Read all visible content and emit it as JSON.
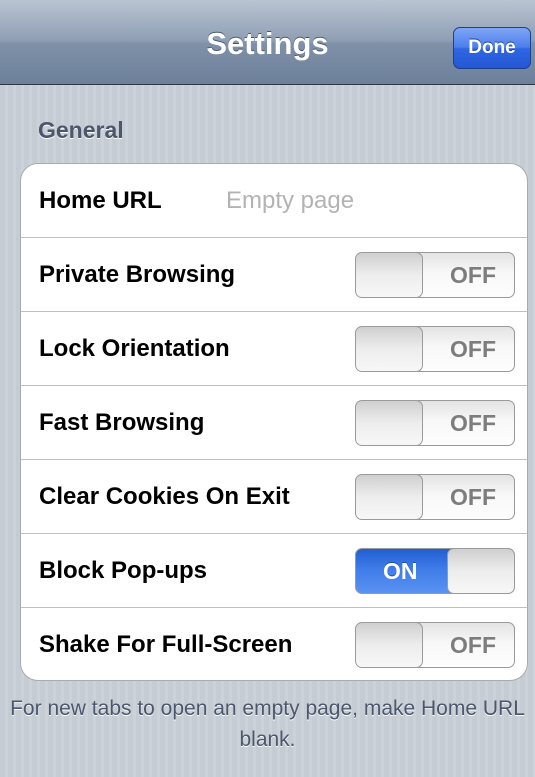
{
  "nav": {
    "title": "Settings",
    "done_label": "Done"
  },
  "section": {
    "header": "General"
  },
  "home_url": {
    "label": "Home URL",
    "value": "",
    "placeholder": "Empty page"
  },
  "toggles": [
    {
      "label": "Private Browsing",
      "state": "OFF"
    },
    {
      "label": "Lock Orientation",
      "state": "OFF"
    },
    {
      "label": "Fast Browsing",
      "state": "OFF"
    },
    {
      "label": "Clear Cookies On Exit",
      "state": "OFF"
    },
    {
      "label": "Block Pop-ups",
      "state": "ON"
    },
    {
      "label": "Shake For Full-Screen",
      "state": "OFF"
    }
  ],
  "footer": {
    "note": "For new tabs to open an empty page, make Home URL blank."
  },
  "colors": {
    "accent": "#2e66e4",
    "nav_bar": "#8f9fb3",
    "background": "#c5ccd4",
    "section_text": "#4c566c"
  }
}
